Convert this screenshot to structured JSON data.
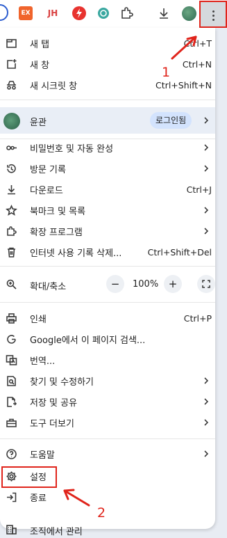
{
  "toolbar": {
    "extension_icons": [
      "ex-extension-icon",
      "jh-extension-icon",
      "bolt-extension-icon",
      "globe-extension-icon",
      "extensions-puzzle-icon"
    ],
    "ex_text": "EX",
    "jh_text": "JH"
  },
  "menu": {
    "new_tab": {
      "label": "새 탭",
      "shortcut": "Ctrl+T"
    },
    "new_window": {
      "label": "새 창",
      "shortcut": "Ctrl+N"
    },
    "incognito": {
      "label": "새 시크릿 창",
      "shortcut": "Ctrl+Shift+N"
    },
    "profile": {
      "name": "윤관",
      "signin": "로그인됨"
    },
    "passwords": {
      "label": "비밀번호 및 자동 완성"
    },
    "history": {
      "label": "방문 기록"
    },
    "downloads": {
      "label": "다운로드",
      "shortcut": "Ctrl+J"
    },
    "bookmarks": {
      "label": "북마크 및 목록"
    },
    "extensions": {
      "label": "확장 프로그램"
    },
    "clear_data": {
      "label": "인터넷 사용 기록 삭제...",
      "shortcut": "Ctrl+Shift+Del"
    },
    "zoom": {
      "label": "확대/축소",
      "minus": "−",
      "value": "100%",
      "plus": "+"
    },
    "print": {
      "label": "인쇄",
      "shortcut": "Ctrl+P"
    },
    "google_search": {
      "label": "Google에서 이 페이지 검색..."
    },
    "translate": {
      "label": "번역..."
    },
    "find_edit": {
      "label": "찾기 및 수정하기"
    },
    "save_share": {
      "label": "저장 및 공유"
    },
    "more_tools": {
      "label": "도구 더보기"
    },
    "help": {
      "label": "도움말"
    },
    "settings": {
      "label": "설정"
    },
    "exit": {
      "label": "종료"
    }
  },
  "managed": {
    "label": "조직에서 관리"
  },
  "annotations": {
    "step1": "1",
    "step2": "2"
  },
  "colors": {
    "annotation": "#e0241b",
    "accent": "#d3e3fd",
    "profile_row_bg": "#e9eef6"
  }
}
